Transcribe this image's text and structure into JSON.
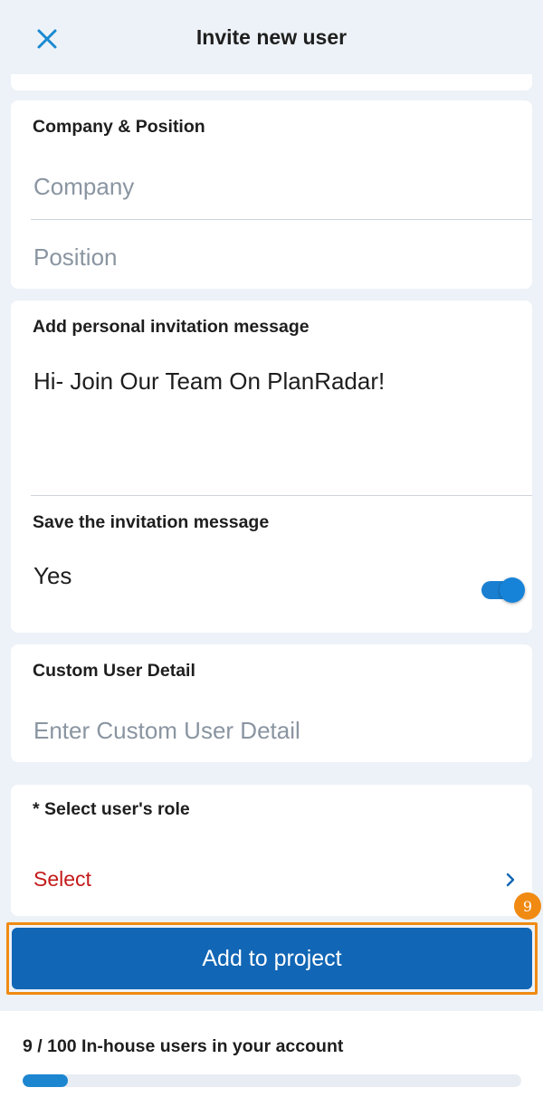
{
  "header": {
    "title": "Invite new user",
    "close_icon": "close-icon",
    "accent_color": "#1a8ad1"
  },
  "company_section": {
    "label": "Company & Position",
    "company_placeholder": "Company",
    "position_placeholder": "Position"
  },
  "message_section": {
    "label": "Add personal invitation message",
    "message_value": "Hi- Join Our Team On PlanRadar!",
    "save_label": "Save the invitation message",
    "save_value": "Yes",
    "save_toggle_on": true
  },
  "custom_detail_section": {
    "label": "Custom User Detail",
    "placeholder": "Enter Custom User Detail"
  },
  "role_section": {
    "label": "* Select user's role",
    "select_text": "Select",
    "chevron_icon": "chevron-right-icon"
  },
  "primary_action": {
    "label": "Add to project",
    "badge": "9",
    "highlight_color": "#f08a12",
    "button_color": "#1166b5"
  },
  "footer": {
    "usage_text": "9 / 100 In-house users in your account",
    "used": 9,
    "total": 100
  }
}
